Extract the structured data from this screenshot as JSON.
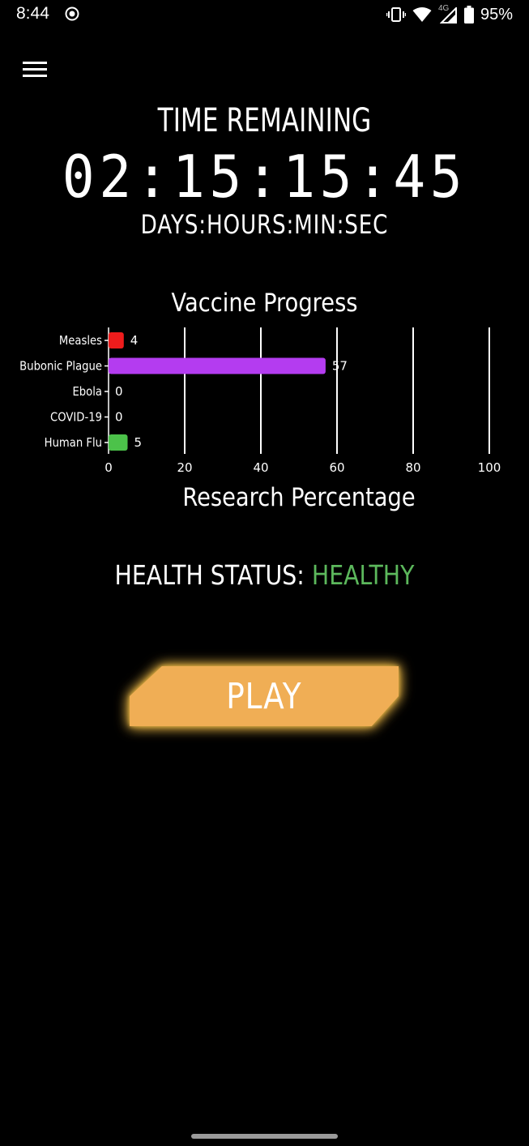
{
  "status_bar": {
    "time": "8:44",
    "network": "4G",
    "battery": "95%"
  },
  "timer": {
    "title": "TIME REMAINING",
    "value": "02:15:15:45",
    "units": "DAYS:HOURS:MIN:SEC"
  },
  "chart_data": {
    "type": "bar",
    "orientation": "horizontal",
    "title": "Vaccine Progress",
    "xlabel": "Research Percentage",
    "ylabel": "",
    "categories": [
      "Measles",
      "Bubonic Plague",
      "Ebola",
      "COVID-19",
      "Human Flu"
    ],
    "values": [
      4,
      57,
      0,
      0,
      5
    ],
    "colors": [
      "#ee1c1c",
      "#b43cf0",
      "#888888",
      "#888888",
      "#4cc24a"
    ],
    "xlim": [
      0,
      100
    ],
    "xticks": [
      0,
      20,
      40,
      60,
      80,
      100
    ],
    "grid": true
  },
  "health": {
    "label": "HEALTH STATUS: ",
    "value": "HEALTHY",
    "value_color": "#5cb85c"
  },
  "play_button": {
    "label": "PLAY",
    "color": "#f0ae55"
  },
  "icons": {
    "menu": "hamburger-menu-icon",
    "record": "screen-record-icon",
    "vibrate": "vibrate-icon",
    "wifi": "wifi-icon",
    "signal": "cell-signal-icon",
    "battery": "battery-icon"
  }
}
